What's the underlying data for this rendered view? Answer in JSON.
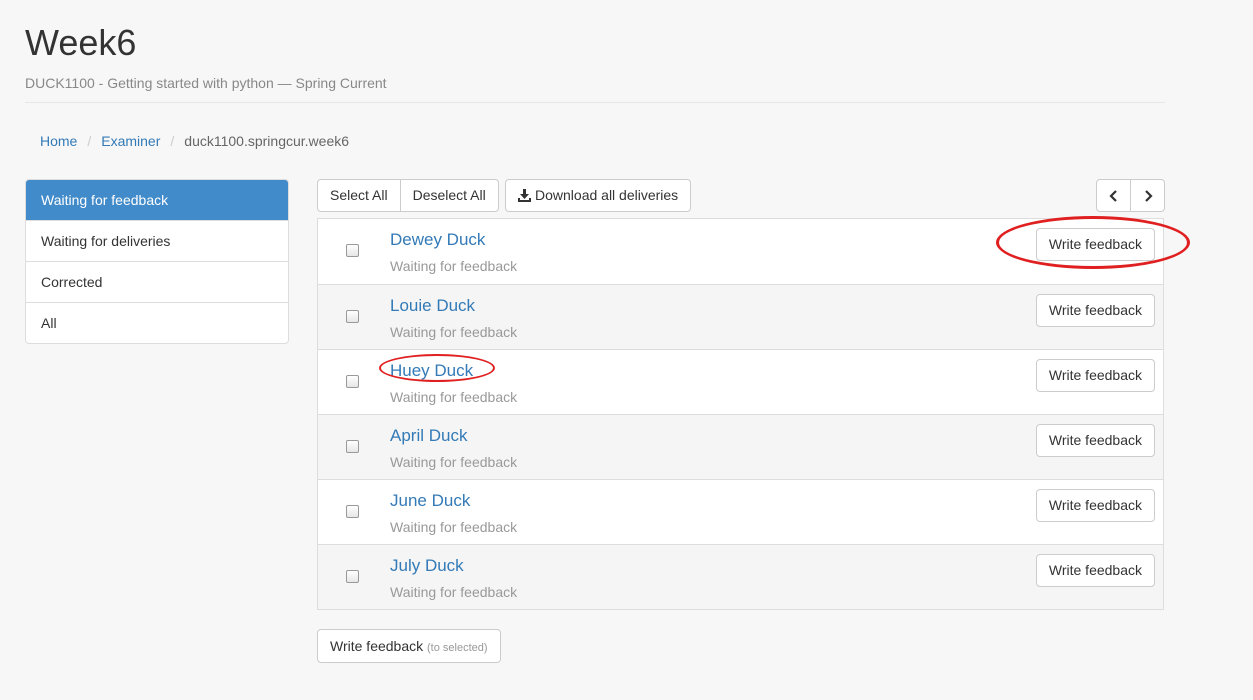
{
  "header": {
    "title": "Week6",
    "subtitle": "DUCK1100 - Getting started with python — Spring Current"
  },
  "breadcrumb": {
    "items": [
      "Home",
      "Examiner"
    ],
    "current": "duck1100.springcur.week6"
  },
  "sidebar": {
    "items": [
      {
        "label": "Waiting for feedback",
        "active": true
      },
      {
        "label": "Waiting for deliveries",
        "active": false
      },
      {
        "label": "Corrected",
        "active": false
      },
      {
        "label": "All",
        "active": false
      }
    ]
  },
  "toolbar": {
    "select_all": "Select All",
    "deselect_all": "Deselect All",
    "download_all": "Download all deliveries",
    "download_icon": "download-icon",
    "prev_icon": "chevron-left-icon",
    "next_icon": "chevron-right-icon"
  },
  "students": [
    {
      "name": "Dewey Duck",
      "status": "Waiting for feedback",
      "action": "Write feedback"
    },
    {
      "name": "Louie Duck",
      "status": "Waiting for feedback",
      "action": "Write feedback"
    },
    {
      "name": "Huey Duck",
      "status": "Waiting for feedback",
      "action": "Write feedback"
    },
    {
      "name": "April Duck",
      "status": "Waiting for feedback",
      "action": "Write feedback"
    },
    {
      "name": "June Duck",
      "status": "Waiting for feedback",
      "action": "Write feedback"
    },
    {
      "name": "July Duck",
      "status": "Waiting for feedback",
      "action": "Write feedback"
    }
  ],
  "bottom": {
    "label": "Write feedback",
    "hint": "(to selected)"
  },
  "colors": {
    "accent": "#428bca",
    "link": "#337ab7",
    "annotation": "#e02020"
  }
}
